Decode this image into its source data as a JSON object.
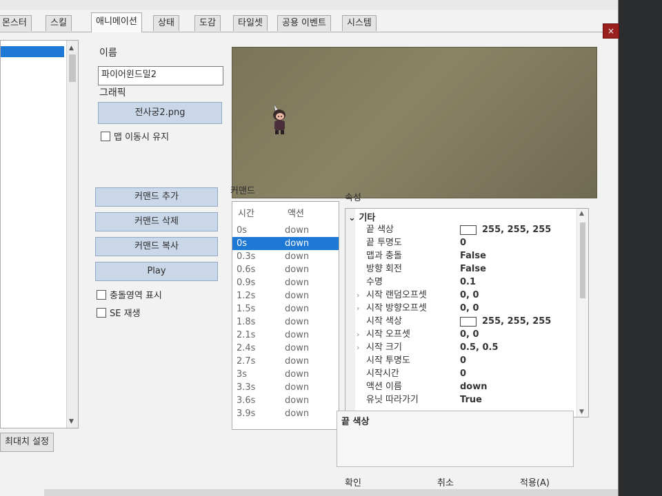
{
  "tabs": [
    {
      "label": "몬스터",
      "active": false
    },
    {
      "label": "스킬",
      "active": false
    },
    {
      "label": "애니메이션",
      "active": true
    },
    {
      "label": "상태",
      "active": false
    },
    {
      "label": "도감",
      "active": false
    },
    {
      "label": "타일셋",
      "active": false
    },
    {
      "label": "공용 이벤트",
      "active": false
    },
    {
      "label": "시스템",
      "active": false
    }
  ],
  "close_glyph": "×",
  "left_panel": {
    "bottom_button": "최대치 설정"
  },
  "form": {
    "name_label": "이름",
    "name_value": "파이어윈드밀2",
    "graphic_label": "그래픽",
    "graphic_value": "전사궁2.png",
    "keep_on_move_label": "맵 이동시 유지"
  },
  "buttons": {
    "add_command": "커맨드 추가",
    "delete_command": "커맨드 삭제",
    "copy_command": "커맨드 복사",
    "play": "Play"
  },
  "checkboxes": {
    "show_collision": "충돌영역 표시",
    "play_se": "SE 재생"
  },
  "command_list": {
    "title": "커맨드",
    "col_time": "시간",
    "col_action": "액션",
    "rows": [
      {
        "time": "0s",
        "action": "down"
      },
      {
        "time": "0s",
        "action": "down"
      },
      {
        "time": "0.3s",
        "action": "down"
      },
      {
        "time": "0.6s",
        "action": "down"
      },
      {
        "time": "0.9s",
        "action": "down"
      },
      {
        "time": "1.2s",
        "action": "down"
      },
      {
        "time": "1.5s",
        "action": "down"
      },
      {
        "time": "1.8s",
        "action": "down"
      },
      {
        "time": "2.1s",
        "action": "down"
      },
      {
        "time": "2.4s",
        "action": "down"
      },
      {
        "time": "2.7s",
        "action": "down"
      },
      {
        "time": "3s",
        "action": "down"
      },
      {
        "time": "3.3s",
        "action": "down"
      },
      {
        "time": "3.6s",
        "action": "down"
      },
      {
        "time": "3.9s",
        "action": "down"
      }
    ],
    "selected_index": 1
  },
  "properties": {
    "title": "속성",
    "category": "기타",
    "rows": [
      {
        "name": "끝 색상",
        "value": "255, 255, 255",
        "swatch": true,
        "expandable": false
      },
      {
        "name": "끝 투명도",
        "value": "0",
        "swatch": false,
        "expandable": false
      },
      {
        "name": "맵과 충돌",
        "value": "False",
        "swatch": false,
        "expandable": false
      },
      {
        "name": "방향 회전",
        "value": "False",
        "swatch": false,
        "expandable": false
      },
      {
        "name": "수명",
        "value": "0.1",
        "swatch": false,
        "expandable": false
      },
      {
        "name": "시작 랜덤오프셋",
        "value": "0, 0",
        "swatch": false,
        "expandable": true
      },
      {
        "name": "시작 방향오프셋",
        "value": "0, 0",
        "swatch": false,
        "expandable": true
      },
      {
        "name": "시작 색상",
        "value": "255, 255, 255",
        "swatch": true,
        "expandable": false
      },
      {
        "name": "시작 오프셋",
        "value": "0, 0",
        "swatch": false,
        "expandable": true
      },
      {
        "name": "시작 크기",
        "value": "0.5, 0.5",
        "swatch": false,
        "expandable": true
      },
      {
        "name": "시작 투명도",
        "value": "0",
        "swatch": false,
        "expandable": false
      },
      {
        "name": "시작시간",
        "value": "0",
        "swatch": false,
        "expandable": false
      },
      {
        "name": "액션 이름",
        "value": "down",
        "swatch": false,
        "expandable": false
      },
      {
        "name": "유닛 따라가기",
        "value": "True",
        "swatch": false,
        "expandable": false
      }
    ],
    "description_title": "끝 색상"
  },
  "footer": {
    "ok": "확인",
    "cancel": "취소",
    "apply": "적용(A)"
  },
  "colors": {
    "selection": "#1e78d6",
    "preview_bg": "#7b7458",
    "close_bg": "#9a1f1f"
  }
}
